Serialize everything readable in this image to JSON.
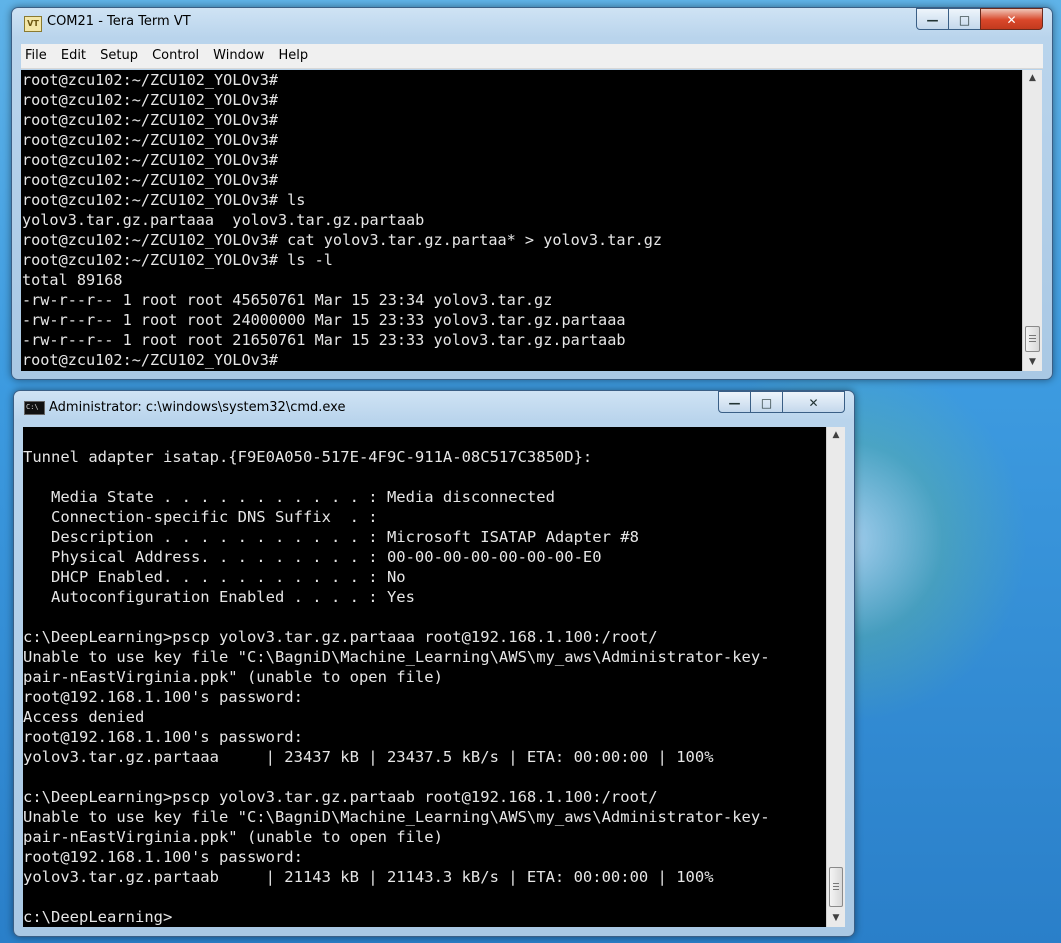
{
  "tera_term": {
    "title": "COM21 - Tera Term VT",
    "icon_label": "VT",
    "menu": [
      "File",
      "Edit",
      "Setup",
      "Control",
      "Window",
      "Help"
    ],
    "lines": [
      "root@zcu102:~/ZCU102_YOLOv3#",
      "root@zcu102:~/ZCU102_YOLOv3#",
      "root@zcu102:~/ZCU102_YOLOv3#",
      "root@zcu102:~/ZCU102_YOLOv3#",
      "root@zcu102:~/ZCU102_YOLOv3#",
      "root@zcu102:~/ZCU102_YOLOv3#",
      "root@zcu102:~/ZCU102_YOLOv3# ls",
      "yolov3.tar.gz.partaaa  yolov3.tar.gz.partaab",
      "root@zcu102:~/ZCU102_YOLOv3# cat yolov3.tar.gz.partaa* > yolov3.tar.gz",
      "root@zcu102:~/ZCU102_YOLOv3# ls -l",
      "total 89168",
      "-rw-r--r-- 1 root root 45650761 Mar 15 23:34 yolov3.tar.gz",
      "-rw-r--r-- 1 root root 24000000 Mar 15 23:33 yolov3.tar.gz.partaaa",
      "-rw-r--r-- 1 root root 21650761 Mar 15 23:33 yolov3.tar.gz.partaab",
      "root@zcu102:~/ZCU102_YOLOv3#"
    ]
  },
  "cmd": {
    "title": "Administrator: c:\\windows\\system32\\cmd.exe",
    "icon_label": "C:\\",
    "lines": [
      "",
      "Tunnel adapter isatap.{F9E0A050-517E-4F9C-911A-08C517C3850D}:",
      "",
      "   Media State . . . . . . . . . . . : Media disconnected",
      "   Connection-specific DNS Suffix  . :",
      "   Description . . . . . . . . . . . : Microsoft ISATAP Adapter #8",
      "   Physical Address. . . . . . . . . : 00-00-00-00-00-00-00-E0",
      "   DHCP Enabled. . . . . . . . . . . : No",
      "   Autoconfiguration Enabled . . . . : Yes",
      "",
      "c:\\DeepLearning>pscp yolov3.tar.gz.partaaa root@192.168.1.100:/root/",
      "Unable to use key file \"C:\\BagniD\\Machine_Learning\\AWS\\my_aws\\Administrator-key-",
      "pair-nEastVirginia.ppk\" (unable to open file)",
      "root@192.168.1.100's password:",
      "Access denied",
      "root@192.168.1.100's password:",
      "yolov3.tar.gz.partaaa     | 23437 kB | 23437.5 kB/s | ETA: 00:00:00 | 100%",
      "",
      "c:\\DeepLearning>pscp yolov3.tar.gz.partaab root@192.168.1.100:/root/",
      "Unable to use key file \"C:\\BagniD\\Machine_Learning\\AWS\\my_aws\\Administrator-key-",
      "pair-nEastVirginia.ppk\" (unable to open file)",
      "root@192.168.1.100's password:",
      "yolov3.tar.gz.partaab     | 21143 kB | 21143.3 kB/s | ETA: 00:00:00 | 100%",
      "",
      "c:\\DeepLearning>"
    ]
  },
  "controls": {
    "minimize": "minimize-icon",
    "maximize": "maximize-icon",
    "close": "close-icon"
  }
}
